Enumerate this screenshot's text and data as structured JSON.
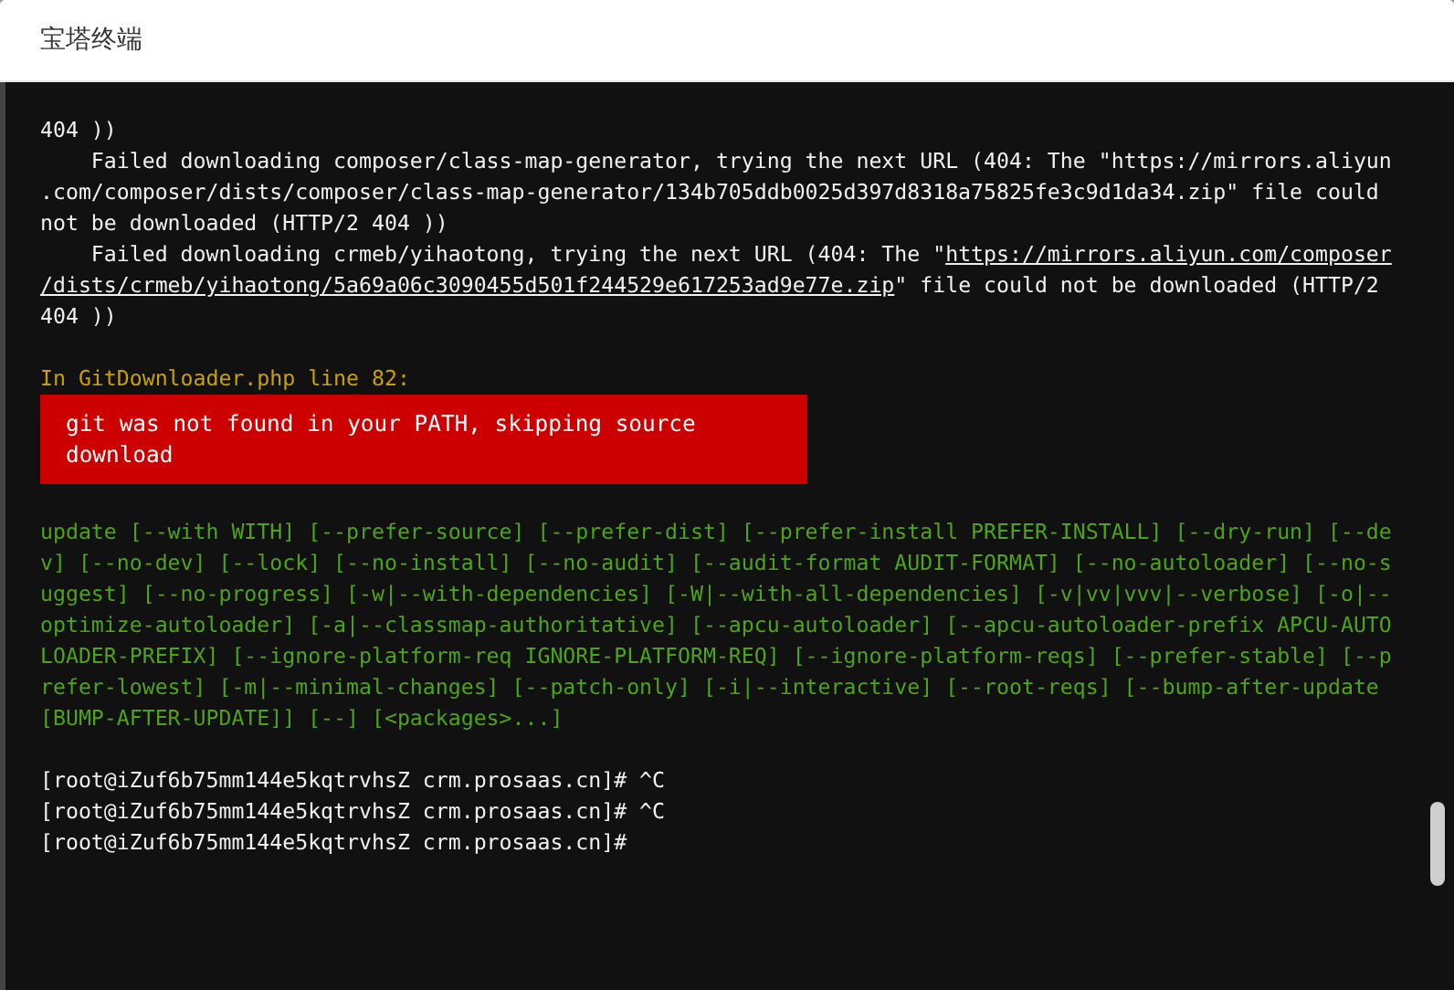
{
  "window": {
    "title": "宝塔终端"
  },
  "terminal": {
    "blocks": [
      {
        "kind": "output",
        "lines": [
          [
            {
              "kind": "plain",
              "text": "404 ))"
            }
          ],
          [
            {
              "kind": "plain",
              "text": "    Failed downloading composer/class-map-generator, trying the next URL (404: The \"https://mirrors.aliyun"
            }
          ],
          [
            {
              "kind": "plain",
              "text": ".com/composer/dists/composer/class-map-generator/134b705ddb0025d397d8318a75825fe3c9d1da34.zip\" file could"
            }
          ],
          [
            {
              "kind": "plain",
              "text": "not be downloaded (HTTP/2 404 ))"
            }
          ],
          [
            {
              "kind": "plain",
              "text": "    Failed downloading crmeb/yihaotong, trying the next URL (404: The \""
            },
            {
              "kind": "link",
              "text": "https://mirrors.aliyun.com/composer"
            }
          ],
          [
            {
              "kind": "link",
              "text": "/dists/crmeb/yihaotong/5a69a06c3090455d501f244529e617253ad9e77e.zip"
            },
            {
              "kind": "plain",
              "text": "\" file could not be downloaded (HTTP/2"
            }
          ],
          [
            {
              "kind": "plain",
              "text": "404 ))"
            }
          ]
        ]
      },
      {
        "kind": "error_heading",
        "lines": [
          [
            {
              "kind": "plain",
              "text": "In GitDownloader.php line 82:"
            }
          ]
        ]
      },
      {
        "kind": "error_box",
        "lines": [
          [
            {
              "kind": "plain",
              "text": "git was not found in your PATH, skipping source download"
            }
          ]
        ]
      },
      {
        "kind": "usage",
        "lines": [
          [
            {
              "kind": "plain",
              "text": "update [--with WITH] [--prefer-source] [--prefer-dist] [--prefer-install PREFER-INSTALL] [--dry-run] [--de"
            }
          ],
          [
            {
              "kind": "plain",
              "text": "v] [--no-dev] [--lock] [--no-install] [--no-audit] [--audit-format AUDIT-FORMAT] [--no-autoloader] [--no-s"
            }
          ],
          [
            {
              "kind": "plain",
              "text": "uggest] [--no-progress] [-w|--with-dependencies] [-W|--with-all-dependencies] [-v|vv|vvv|--verbose] [-o|--"
            }
          ],
          [
            {
              "kind": "plain",
              "text": "optimize-autoloader] [-a|--classmap-authoritative] [--apcu-autoloader] [--apcu-autoloader-prefix APCU-AUTO"
            }
          ],
          [
            {
              "kind": "plain",
              "text": "LOADER-PREFIX] [--ignore-platform-req IGNORE-PLATFORM-REQ] [--ignore-platform-reqs] [--prefer-stable] [--p"
            }
          ],
          [
            {
              "kind": "plain",
              "text": "refer-lowest] [-m|--minimal-changes] [--patch-only] [-i|--interactive] [--root-reqs] [--bump-after-update"
            }
          ],
          [
            {
              "kind": "plain",
              "text": "[BUMP-AFTER-UPDATE]] [--] [<packages>...]"
            }
          ]
        ]
      },
      {
        "kind": "prompt",
        "lines": [
          [
            {
              "kind": "plain",
              "text": "[root@iZuf6b75mm144e5kqtrvhsZ crm.prosaas.cn]# ^C"
            }
          ],
          [
            {
              "kind": "plain",
              "text": "[root@iZuf6b75mm144e5kqtrvhsZ crm.prosaas.cn]# ^C"
            }
          ],
          [
            {
              "kind": "plain",
              "text": "[root@iZuf6b75mm144e5kqtrvhsZ crm.prosaas.cn]#"
            }
          ]
        ]
      }
    ]
  }
}
